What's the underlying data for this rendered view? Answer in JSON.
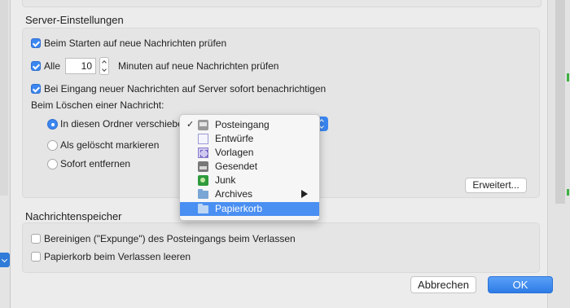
{
  "server_section": {
    "title": "Server-Einstellungen",
    "check_on_start": {
      "label": "Beim Starten auf neue Nachrichten prüfen",
      "checked": true
    },
    "check_every": {
      "prefix": "Alle",
      "value": "10",
      "suffix": "Minuten auf neue Nachrichten prüfen",
      "checked": true
    },
    "notify_immediately": {
      "label": "Bei Eingang neuer Nachrichten auf Server sofort benachrichtigen",
      "checked": true
    },
    "delete_heading": "Beim Löschen einer Nachricht:",
    "delete_options": [
      {
        "label": "In diesen Ordner verschieben",
        "selected": true
      },
      {
        "label": "Als gelöscht markieren",
        "selected": false
      },
      {
        "label": "Sofort entfernen",
        "selected": false
      }
    ],
    "advanced_button": "Erweitert..."
  },
  "folder_menu": {
    "items": [
      {
        "label": "Posteingang",
        "icon": "inbox-icon",
        "checked": true
      },
      {
        "label": "Entwürfe",
        "icon": "drafts-icon"
      },
      {
        "label": "Vorlagen",
        "icon": "templates-icon"
      },
      {
        "label": "Gesendet",
        "icon": "sent-icon"
      },
      {
        "label": "Junk",
        "icon": "junk-icon"
      },
      {
        "label": "Archives",
        "icon": "folder-icon",
        "has_submenu": true
      },
      {
        "label": "Papierkorb",
        "icon": "folder-icon",
        "highlighted": true
      }
    ]
  },
  "storage_section": {
    "title": "Nachrichtenspeicher",
    "expunge_on_exit": {
      "label": "Bereinigen (\"Expunge\") des Posteingangs beim Verlassen",
      "checked": false
    },
    "empty_trash_on_exit": {
      "label": "Papierkorb beim Verlassen leeren",
      "checked": false
    }
  },
  "footer": {
    "cancel_label": "Abbrechen",
    "ok_label": "OK"
  },
  "colors": {
    "accent": "#3b86f0",
    "menu_highlight": "#4a8ff2"
  }
}
